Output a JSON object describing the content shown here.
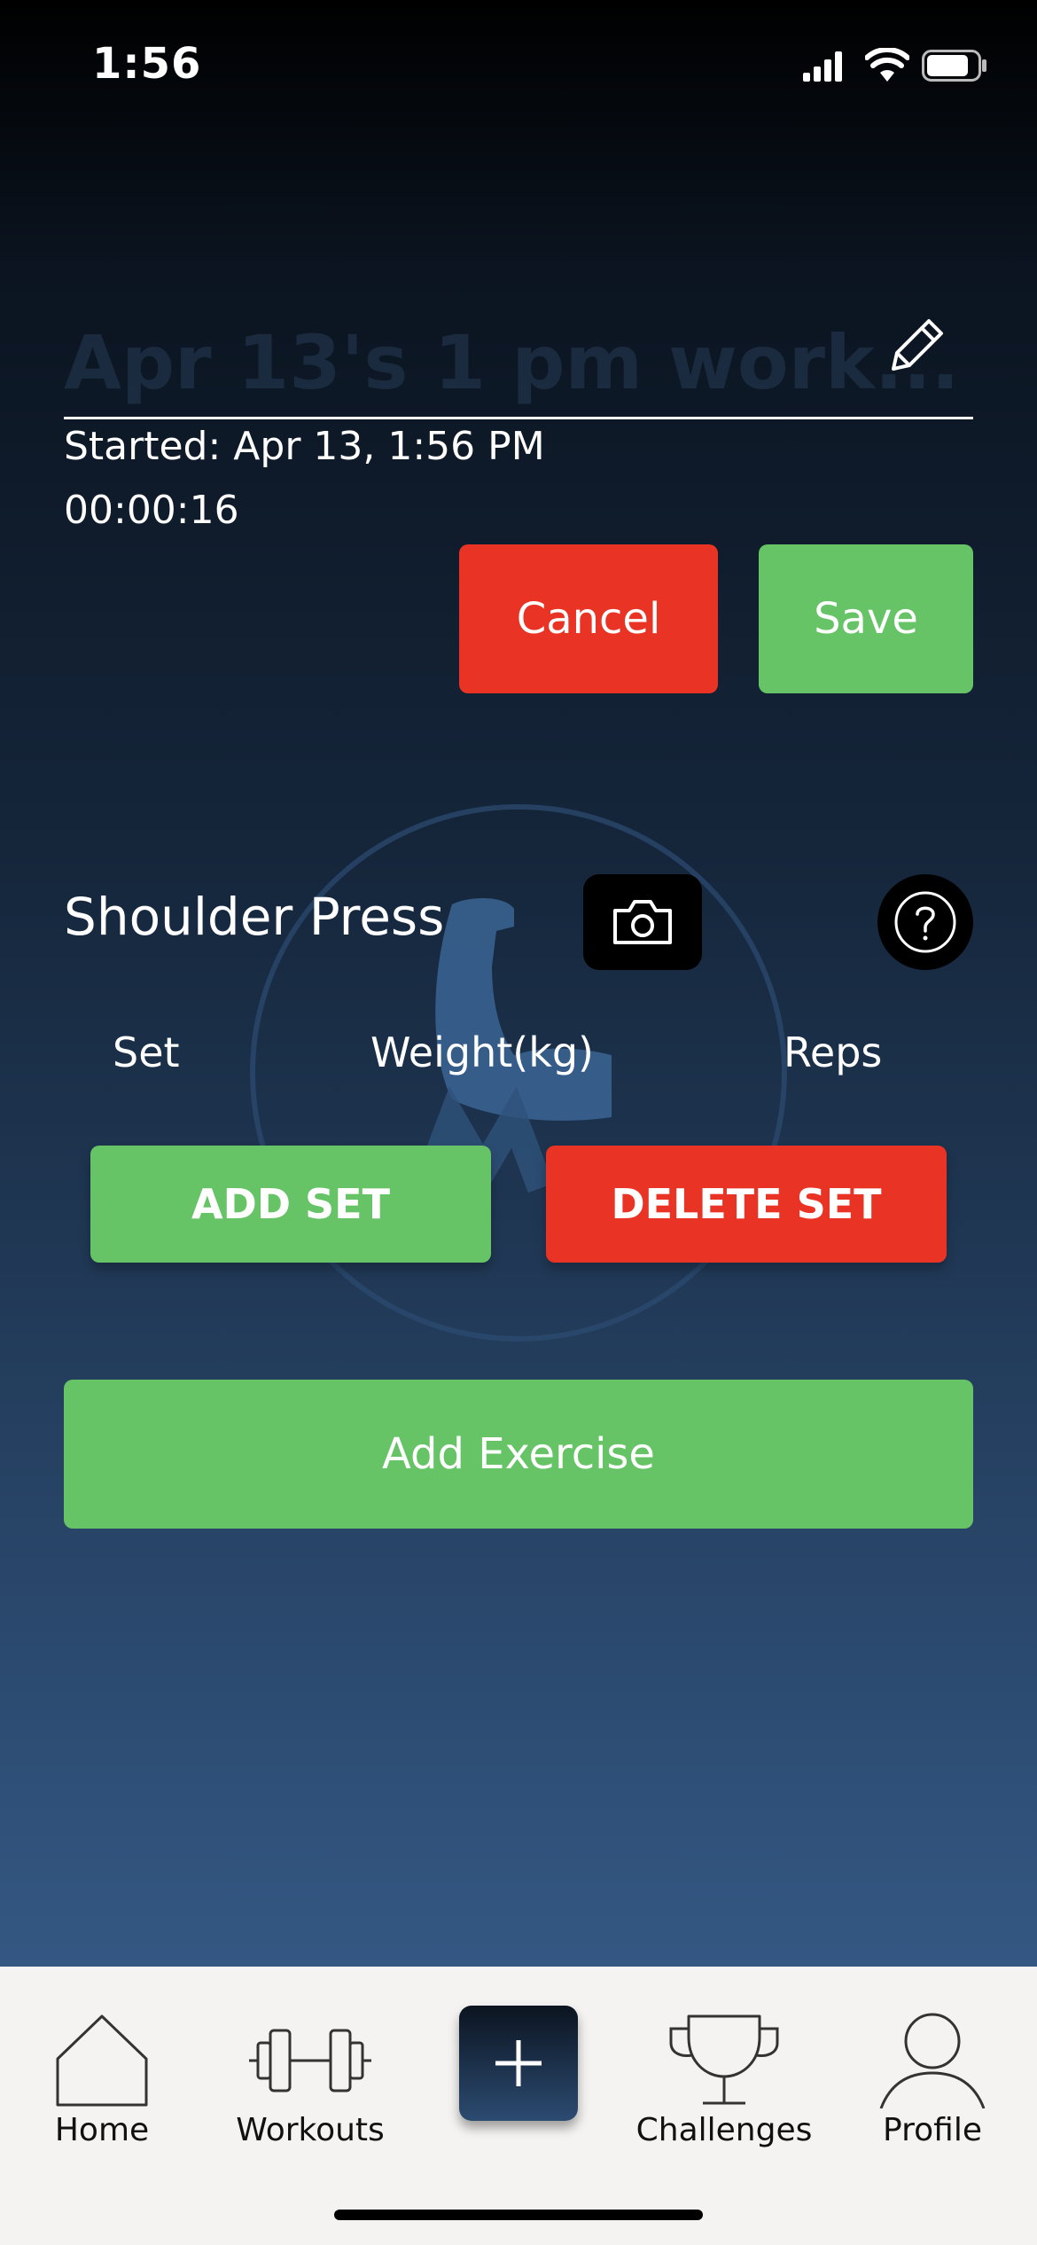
{
  "status_bar": {
    "time": "1:56"
  },
  "workout": {
    "title": "Apr 13's 1 pm work...",
    "started": "Started: Apr 13, 1:56 PM",
    "timer": "00:00:16"
  },
  "actions": {
    "cancel_label": "Cancel",
    "save_label": "Save"
  },
  "exercise": {
    "name": "Shoulder Press",
    "columns": [
      "Set",
      "Weight(kg)",
      "Reps"
    ],
    "add_set_label": "ADD SET",
    "delete_set_label": "DELETE SET"
  },
  "add_exercise_label": "Add Exercise",
  "tabbar": {
    "items": [
      {
        "label": "Home",
        "icon": "home-icon"
      },
      {
        "label": "Workouts",
        "icon": "dumbbell-icon"
      },
      {
        "label": "",
        "icon": "plus-icon"
      },
      {
        "label": "Challenges",
        "icon": "trophy-icon"
      },
      {
        "label": "Profile",
        "icon": "person-icon"
      }
    ]
  },
  "colors": {
    "red": "#e93325",
    "green": "#66c466",
    "tabbar_bg": "#f4f3f2",
    "gradient_top": "#000000",
    "gradient_bottom": "#3b6494"
  }
}
